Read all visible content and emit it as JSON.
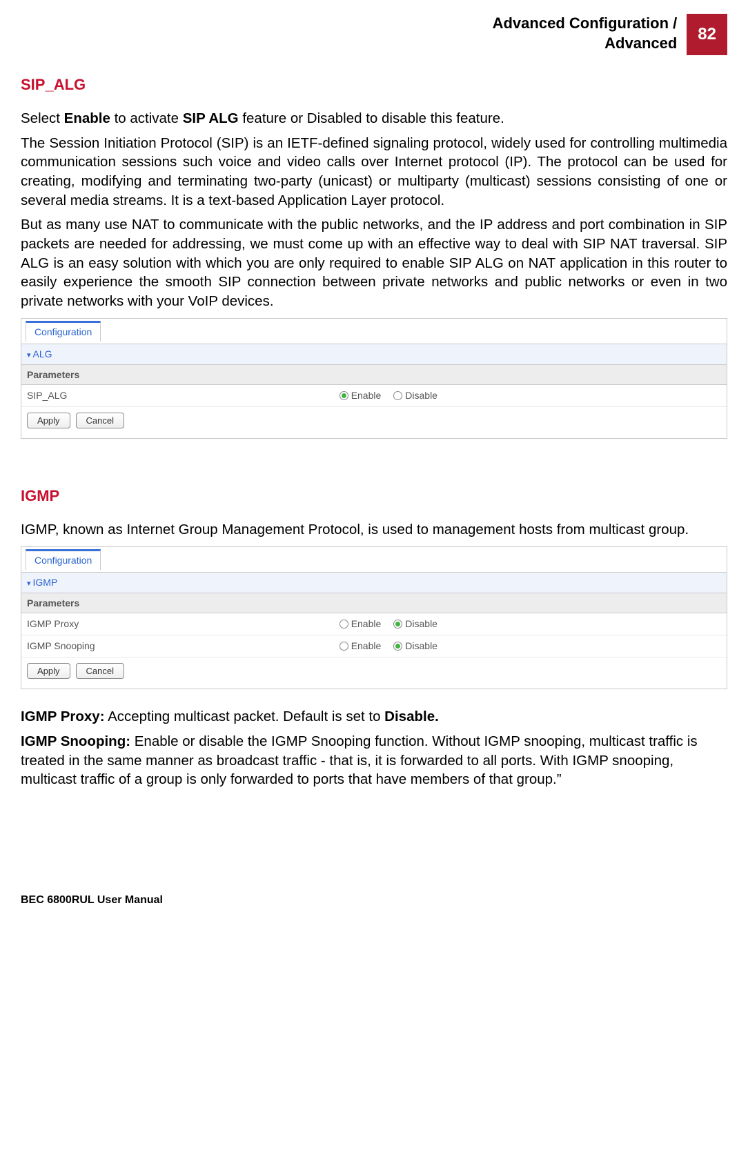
{
  "header": {
    "title_line1": "Advanced Configuration /",
    "title_line2": "Advanced",
    "page_number": "82"
  },
  "sip_alg": {
    "heading": "SIP_ALG",
    "intro_prefix": "Select ",
    "intro_bold1": "Enable",
    "intro_mid": " to activate ",
    "intro_bold2": "SIP ALG",
    "intro_suffix": " feature or Disabled to disable this feature.",
    "para1": "The Session Initiation Protocol (SIP) is an IETF-defined signaling protocol, widely used for controlling multimedia communication sessions such voice and video calls over Internet protocol (IP). The protocol can be used for creating, modifying and terminating two-party (unicast) or multiparty (multicast) sessions consisting of one or several media streams. It is a text-based Application Layer protocol.",
    "para2": "But as many use NAT to communicate with the public networks, and the IP address and port combination in SIP packets are needed for addressing, we must come up with an effective way to deal with SIP NAT traversal. SIP ALG is an easy solution with which you are only required to enable SIP ALG on NAT application in this router to easily experience the smooth SIP connection between private networks and public networks or even in two private networks with your VoIP devices.",
    "panel": {
      "tab": "Configuration",
      "section": "ALG",
      "params_label": "Parameters",
      "row_label": "SIP_ALG",
      "enable": "Enable",
      "disable": "Disable",
      "apply": "Apply",
      "cancel": "Cancel"
    }
  },
  "igmp": {
    "heading": "IGMP",
    "para1": "IGMP, known as Internet Group Management Protocol, is used to management hosts from multicast group.",
    "panel": {
      "tab": "Configuration",
      "section": "IGMP",
      "params_label": "Parameters",
      "row1_label": "IGMP Proxy",
      "row2_label": "IGMP Snooping",
      "enable": "Enable",
      "disable": "Disable",
      "apply": "Apply",
      "cancel": "Cancel"
    },
    "proxy_label": "IGMP Proxy:",
    "proxy_text_prefix": " Accepting multicast packet. Default is set to ",
    "proxy_text_bold": "Disable.",
    "snooping_label": "IGMP Snooping:",
    "snooping_text": " Enable or disable the IGMP Snooping function. Without IGMP snooping, multicast traffic is treated in the same manner as broadcast traffic - that is, it is forwarded to all ports. With IGMP snooping, multicast traffic of a group is only forwarded to ports that have members of that group.”"
  },
  "footer": "BEC 6800RUL User Manual"
}
